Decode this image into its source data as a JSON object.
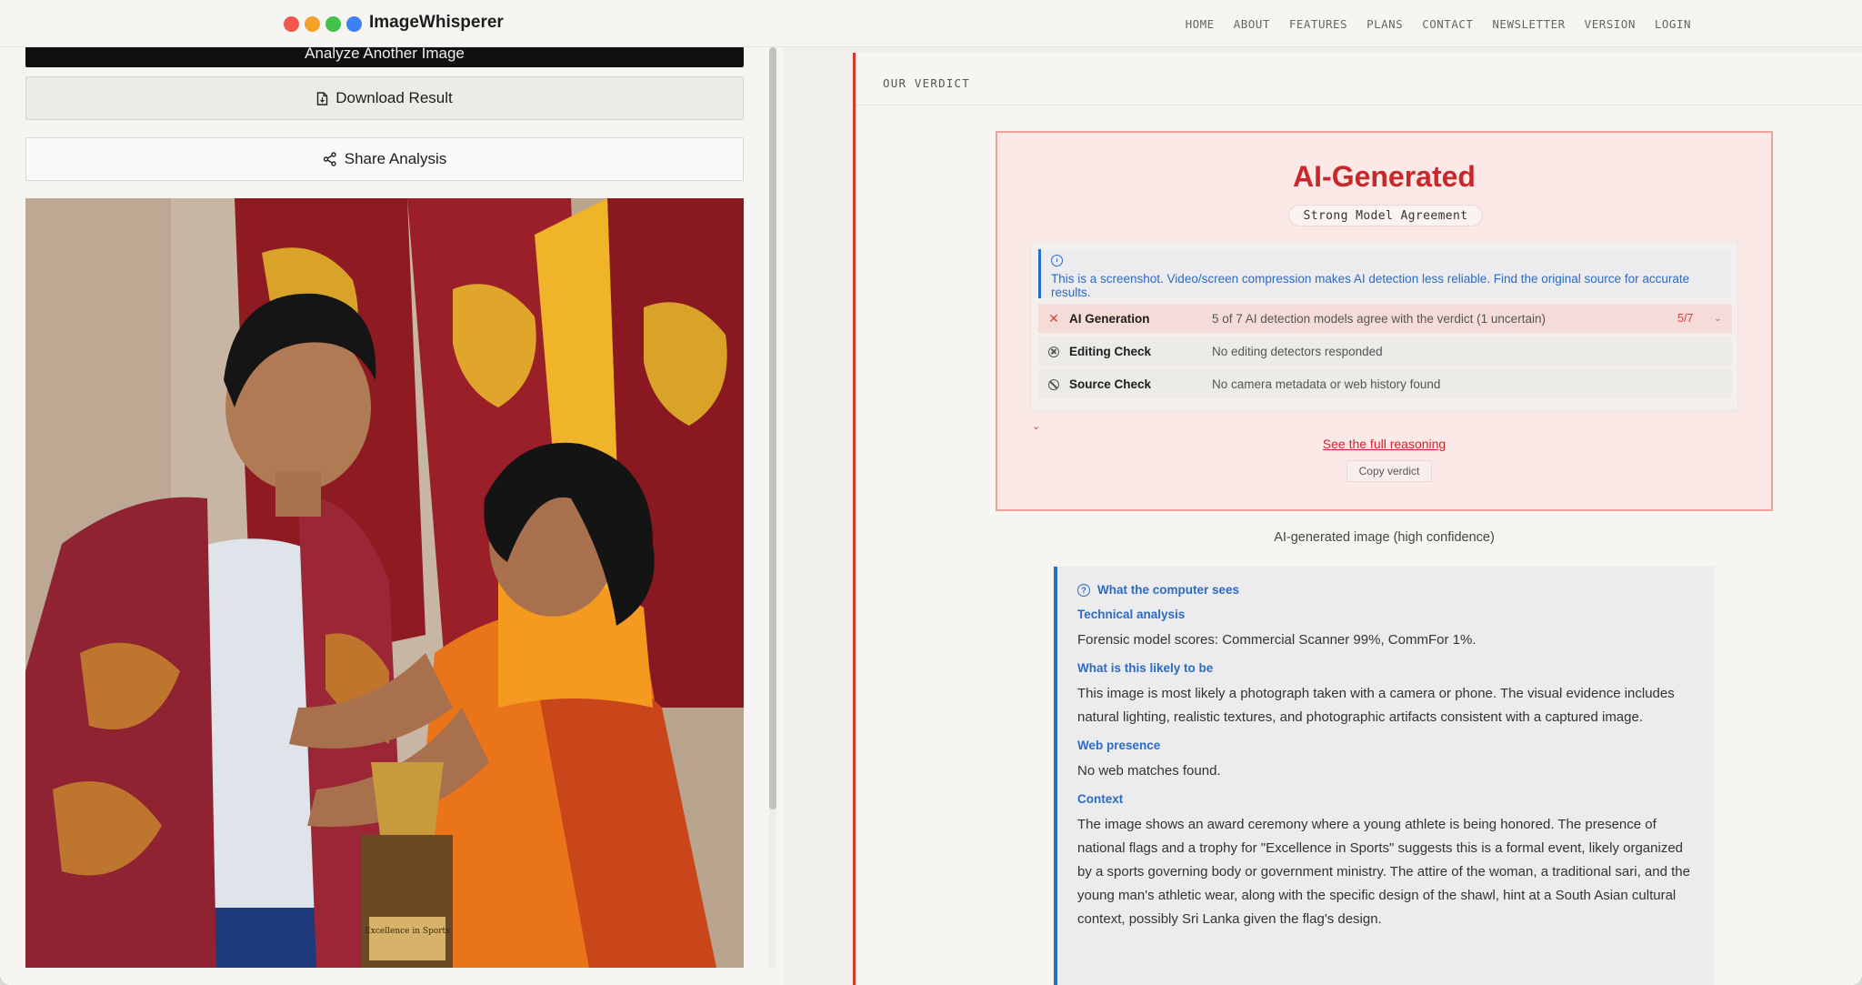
{
  "app": {
    "name": "ImageWhisperer",
    "traffic_colors": [
      "#f0584e",
      "#f4a22c",
      "#42c24a",
      "#3b82f6"
    ]
  },
  "nav": {
    "items": [
      "HOME",
      "ABOUT",
      "FEATURES",
      "PLANS",
      "CONTACT",
      "NEWSLETTER",
      "VERSION",
      "LOGIN"
    ]
  },
  "left": {
    "analyze_label": "Analyze Another Image",
    "download_label": "Download Result",
    "share_label": "Share Analysis",
    "trophy_text": "Excellence in Sports"
  },
  "verdict": {
    "section_label": "OUR VERDICT",
    "title": "AI-Generated",
    "agreement": "Strong Model Agreement",
    "notice": "This is a screenshot. Video/screen compression makes AI detection less reliable. Find the original source for accurate results.",
    "checks": [
      {
        "label": "AI Generation",
        "desc": "5 of 7 AI detection models agree with the verdict (1 uncertain)",
        "score": "5/7"
      },
      {
        "label": "Editing Check",
        "desc": "No editing detectors responded"
      },
      {
        "label": "Source Check",
        "desc": "No camera metadata or web history found"
      }
    ],
    "full_reasoning": "See the full reasoning",
    "copy_label": "Copy verdict",
    "caption": "AI-generated image (high confidence)",
    "accent": "#c9282b"
  },
  "computer_sees": {
    "heading": "What the computer sees",
    "technical_title": "Technical analysis",
    "technical_text": "Forensic model scores: Commercial Scanner 99%, CommFor 1%.",
    "likely_title": "What is this likely to be",
    "likely_text": "This image is most likely a photograph taken with a camera or phone. The visual evidence includes natural lighting, realistic textures, and photographic artifacts consistent with a captured image.",
    "web_title": "Web presence",
    "web_text": "No web matches found.",
    "context_title": "Context",
    "context_text": "The image shows an award ceremony where a young athlete is being honored. The presence of national flags and a trophy for \"Excellence in Sports\" suggests this is a formal event, likely organized by a sports governing body or government ministry. The attire of the woman, a traditional sari, and the young man's athletic wear, along with the specific design of the shawl, hint at a South Asian cultural context, possibly Sri Lanka given the flag's design.",
    "accent": "#2b6cc4"
  }
}
